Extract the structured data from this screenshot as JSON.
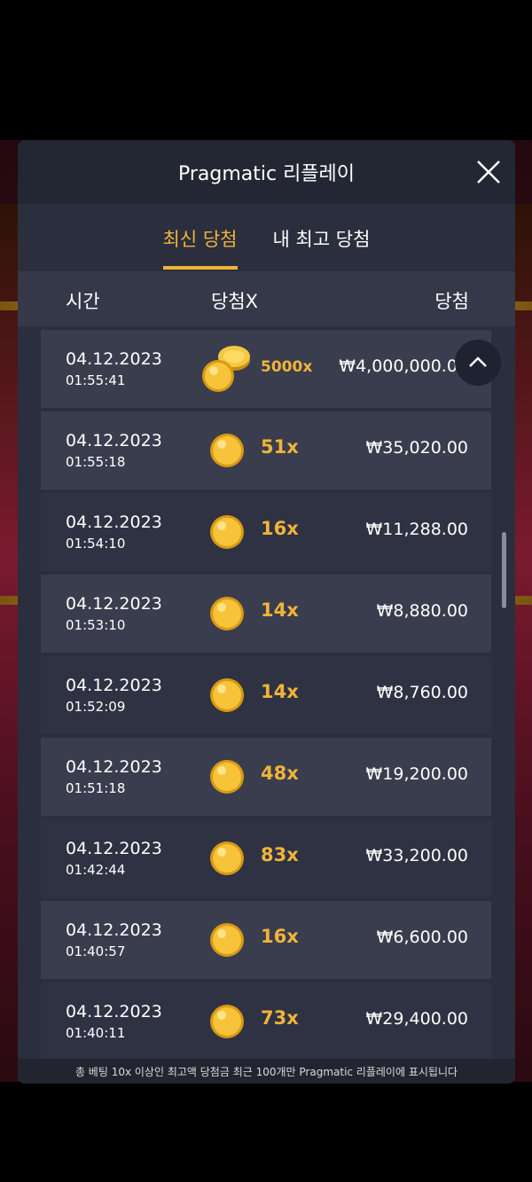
{
  "modal": {
    "title": "Pragmatic 리플레이",
    "tabs": [
      {
        "label": "최신 당첨",
        "active": true
      },
      {
        "label": "내 최고 당첨",
        "active": false
      }
    ],
    "columns": {
      "time": "시간",
      "multiplier": "당첨X",
      "win": "당첨"
    },
    "rows": [
      {
        "date": "04.12.2023",
        "time": "01:55:41",
        "multiplier": "5000x",
        "amount": "₩4,000,000.00",
        "coin": "coin-stack-icon"
      },
      {
        "date": "04.12.2023",
        "time": "01:55:18",
        "multiplier": "51x",
        "amount": "₩35,020.00",
        "coin": "coin-icon"
      },
      {
        "date": "04.12.2023",
        "time": "01:54:10",
        "multiplier": "16x",
        "amount": "₩11,288.00",
        "coin": "coin-icon"
      },
      {
        "date": "04.12.2023",
        "time": "01:53:10",
        "multiplier": "14x",
        "amount": "₩8,880.00",
        "coin": "coin-icon"
      },
      {
        "date": "04.12.2023",
        "time": "01:52:09",
        "multiplier": "14x",
        "amount": "₩8,760.00",
        "coin": "coin-icon"
      },
      {
        "date": "04.12.2023",
        "time": "01:51:18",
        "multiplier": "48x",
        "amount": "₩19,200.00",
        "coin": "coin-icon"
      },
      {
        "date": "04.12.2023",
        "time": "01:42:44",
        "multiplier": "83x",
        "amount": "₩33,200.00",
        "coin": "coin-icon"
      },
      {
        "date": "04.12.2023",
        "time": "01:40:57",
        "multiplier": "16x",
        "amount": "₩6,600.00",
        "coin": "coin-icon"
      },
      {
        "date": "04.12.2023",
        "time": "01:40:11",
        "multiplier": "73x",
        "amount": "₩29,400.00",
        "coin": "coin-icon"
      }
    ],
    "footer": "총 베팅 10x 이상인 최고액 당첨금 최근 100개만 Pragmatic 리플레이에 표시됩니다"
  },
  "colors": {
    "accent": "#f0b43a",
    "panel": "#2b2e3c",
    "row": "#3a3d4d",
    "row_alt": "#2f3242"
  }
}
